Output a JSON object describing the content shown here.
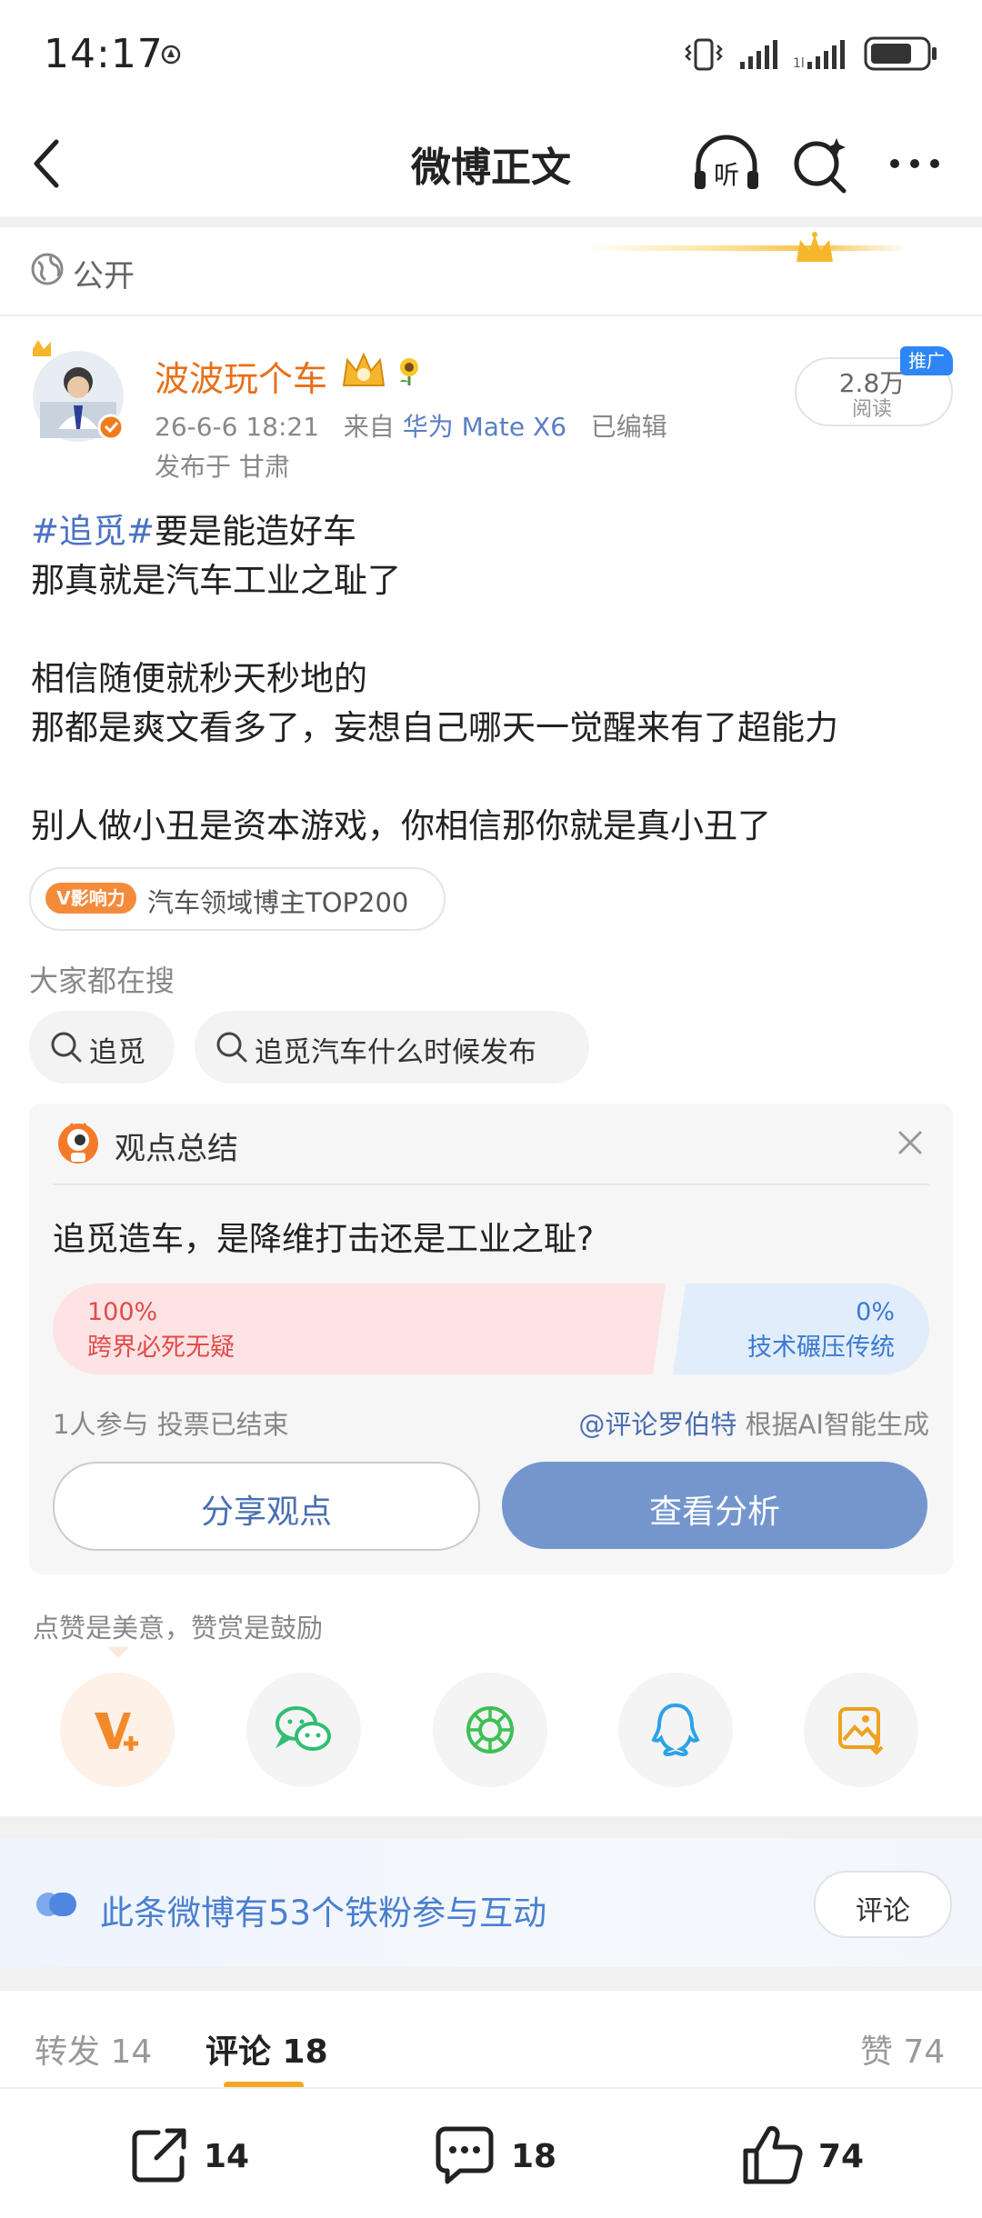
{
  "status_bar": {
    "time": "14:17"
  },
  "nav": {
    "title": "微博正文"
  },
  "visibility": {
    "label": "公开"
  },
  "post": {
    "author": "波波玩个车",
    "date": "26-6-6 18:21",
    "from_label": "来自",
    "device": "华为 Mate X6",
    "edited": "已编辑",
    "location": "发布于 甘肃",
    "read_count": "2.8万",
    "read_label": "阅读",
    "promo_badge": "推广",
    "hashtag": "#追觅#",
    "lines": [
      "要是能造好车",
      "那真就是汽车工业之耻了",
      "相信随便就秒天秒地的",
      "那都是爽文看多了，妄想自己哪天一觉醒来有了超能力",
      "别人做小丑是资本游戏，你相信那你就是真小丑了"
    ]
  },
  "influence": {
    "badge": "V影响力",
    "text": "汽车领域博主TOP200"
  },
  "search": {
    "title": "大家都在搜",
    "chips": [
      "追觅",
      "追觅汽车什么时候发布"
    ]
  },
  "opinion_card": {
    "title": "观点总结",
    "question": "追觅造车，是降维打击还是工业之耻?",
    "options": [
      {
        "percent": "100%",
        "label": "跨界必死无疑",
        "value": 100
      },
      {
        "percent": "0%",
        "label": "技术碾压传统",
        "value": 0
      }
    ],
    "participants": "1人参与  投票已结束",
    "ai_bot": "@评论罗伯特",
    "ai_suffix": "根据AI智能生成",
    "share_label": "分享观点",
    "analysis_label": "查看分析"
  },
  "like_hint": "点赞是美意，赞赏是鼓励",
  "share_targets": [
    "weibo-v-plus-icon",
    "wechat-icon",
    "moments-icon",
    "qq-icon",
    "save-image-icon"
  ],
  "fans_banner": {
    "text": "此条微博有53个铁粉参与互动",
    "button": "评论"
  },
  "tabs": {
    "repost": "转发 14",
    "comment": "评论 18",
    "like": "赞 74"
  },
  "bottom_bar": {
    "repost": "14",
    "comment": "18",
    "like": "74"
  },
  "colors": {
    "accent_orange": "#e86f19",
    "link_blue": "#4a72c2",
    "vote_red": "#e14b4b",
    "vote_blue": "#3a7ad1",
    "analysis_button": "#7496cd",
    "tab_underline": "#f5a623"
  }
}
